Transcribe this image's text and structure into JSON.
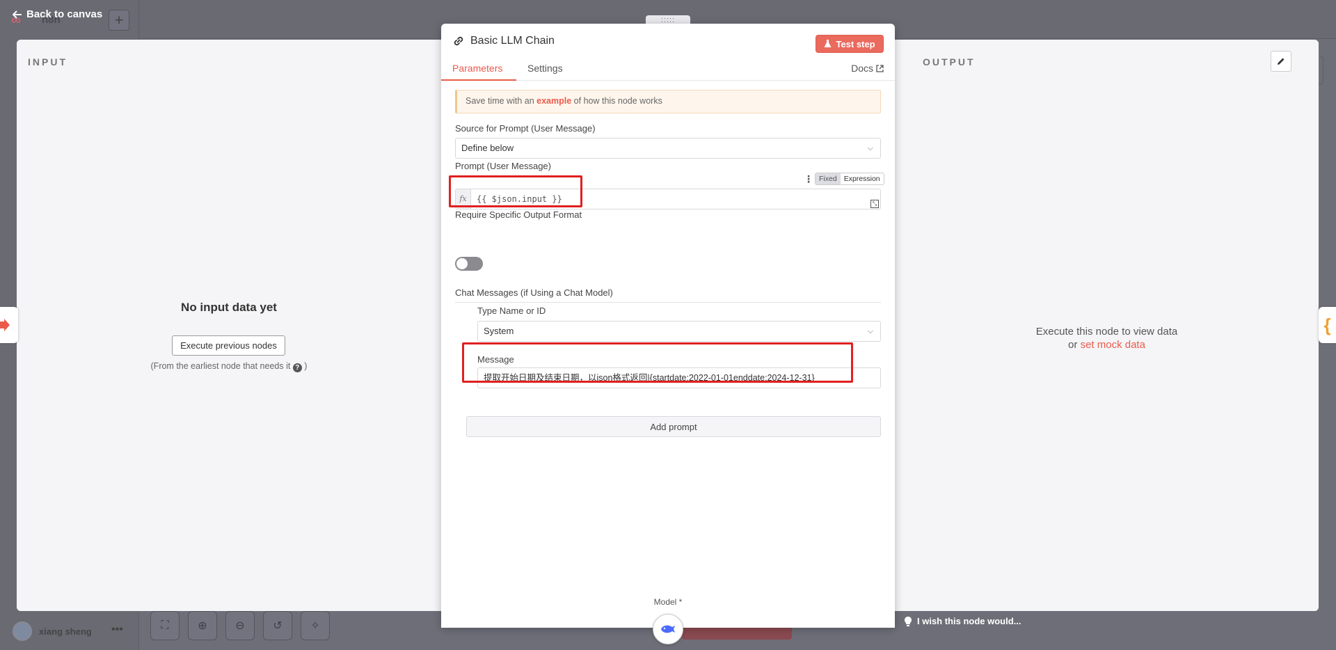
{
  "nav": {
    "back_label": "Back to canvas"
  },
  "background": {
    "workflow_name": "n8n",
    "user_name": "xiang sheng"
  },
  "input_panel": {
    "title": "INPUT",
    "empty_title": "No input data yet",
    "execute_button": "Execute previous nodes",
    "hint_prefix": "(From the earliest node that needs it",
    "hint_suffix": ")"
  },
  "output_panel": {
    "title": "OUTPUT",
    "message": "Execute this node to view data",
    "or": "or",
    "mock_link": "set mock data"
  },
  "node": {
    "title": "Basic LLM Chain",
    "test_button": "Test step",
    "tabs": [
      "Parameters",
      "Settings"
    ],
    "docs_label": "Docs"
  },
  "params": {
    "tip_prefix": "Save time with an",
    "tip_link": "example",
    "tip_suffix": "of how this node works",
    "source_label": "Source for Prompt (User Message)",
    "source_value": "Define below",
    "prompt_label": "Prompt (User Message)",
    "mode_fixed": "Fixed",
    "mode_expression": "Expression",
    "prompt_value": "{{ $json.input }}",
    "fx_label": "fx",
    "require_format_label": "Require Specific Output Format",
    "chat_section": "Chat Messages (if Using a Chat Model)",
    "type_label": "Type Name or ID",
    "type_value": "System",
    "message_label": "Message",
    "message_value": "提取开始日期及结束日期，以json格式返回|{startdate:2022-01-01enddate:2024-12-31}",
    "add_prompt": "Add prompt",
    "model_label": "Model *"
  },
  "footer": {
    "wish_label": "I wish this node would..."
  },
  "colors": {
    "accent": "#ea5a4b",
    "highlight": "#e02020",
    "output_brace": "#f0a030"
  }
}
